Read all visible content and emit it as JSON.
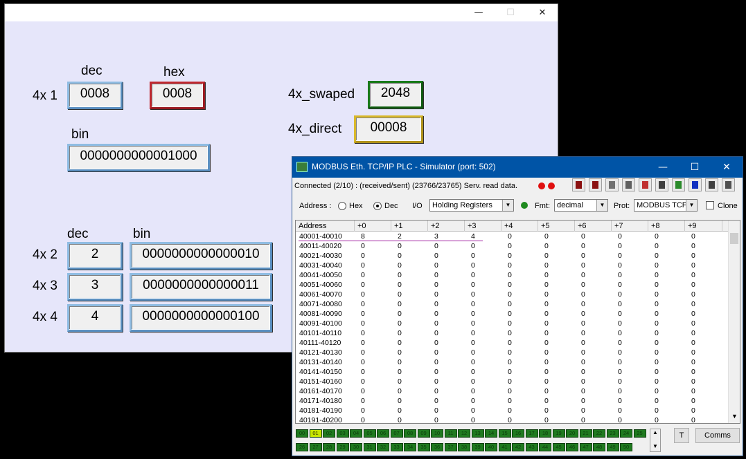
{
  "hmi": {
    "caption": {
      "minimize": "—",
      "maximize": "☐",
      "close": "✕"
    },
    "row1_label": "4x 1",
    "dec_header": "dec",
    "hex_header": "hex",
    "bin_header": "bin",
    "reg1_dec": "0008",
    "reg1_hex": "0008",
    "reg1_bin": "0000000000001000",
    "swaped_label": "4x_swaped",
    "swaped_value": "2048",
    "direct_label": "4x_direct",
    "direct_value": "00008",
    "lower_dec_header": "dec",
    "lower_bin_header": "bin",
    "rows": [
      {
        "label": "4x 2",
        "dec": "2",
        "bin": "0000000000000010"
      },
      {
        "label": "4x 3",
        "dec": "3",
        "bin": "0000000000000011"
      },
      {
        "label": "4x 4",
        "dec": "4",
        "bin": "0000000000000100"
      }
    ]
  },
  "sim": {
    "title": "MODBUS Eth. TCP/IP PLC - Simulator (port: 502)",
    "status": "Connected (2/10) : (received/sent) (23766/23765) Serv. read data.",
    "address_label": "Address :",
    "hex_label": "Hex",
    "dec_label": "Dec",
    "io_label": "I/O",
    "io_value": "Holding Registers",
    "fmt_label": "Fmt:",
    "fmt_value": "decimal",
    "prot_label": "Prot:",
    "prot_value": "MODBUS TCP",
    "clone_label": "Clone",
    "columns": [
      "Address",
      "+0",
      "+1",
      "+2",
      "+3",
      "+4",
      "+5",
      "+6",
      "+7",
      "+8",
      "+9"
    ],
    "rows": [
      {
        "addr": "40001-40010",
        "vals": [
          "8",
          "2",
          "3",
          "4",
          "0",
          "0",
          "0",
          "0",
          "0",
          "0"
        ]
      },
      {
        "addr": "40011-40020",
        "vals": [
          "0",
          "0",
          "0",
          "0",
          "0",
          "0",
          "0",
          "0",
          "0",
          "0"
        ]
      },
      {
        "addr": "40021-40030",
        "vals": [
          "0",
          "0",
          "0",
          "0",
          "0",
          "0",
          "0",
          "0",
          "0",
          "0"
        ]
      },
      {
        "addr": "40031-40040",
        "vals": [
          "0",
          "0",
          "0",
          "0",
          "0",
          "0",
          "0",
          "0",
          "0",
          "0"
        ]
      },
      {
        "addr": "40041-40050",
        "vals": [
          "0",
          "0",
          "0",
          "0",
          "0",
          "0",
          "0",
          "0",
          "0",
          "0"
        ]
      },
      {
        "addr": "40051-40060",
        "vals": [
          "0",
          "0",
          "0",
          "0",
          "0",
          "0",
          "0",
          "0",
          "0",
          "0"
        ]
      },
      {
        "addr": "40061-40070",
        "vals": [
          "0",
          "0",
          "0",
          "0",
          "0",
          "0",
          "0",
          "0",
          "0",
          "0"
        ]
      },
      {
        "addr": "40071-40080",
        "vals": [
          "0",
          "0",
          "0",
          "0",
          "0",
          "0",
          "0",
          "0",
          "0",
          "0"
        ]
      },
      {
        "addr": "40081-40090",
        "vals": [
          "0",
          "0",
          "0",
          "0",
          "0",
          "0",
          "0",
          "0",
          "0",
          "0"
        ]
      },
      {
        "addr": "40091-40100",
        "vals": [
          "0",
          "0",
          "0",
          "0",
          "0",
          "0",
          "0",
          "0",
          "0",
          "0"
        ]
      },
      {
        "addr": "40101-40110",
        "vals": [
          "0",
          "0",
          "0",
          "0",
          "0",
          "0",
          "0",
          "0",
          "0",
          "0"
        ]
      },
      {
        "addr": "40111-40120",
        "vals": [
          "0",
          "0",
          "0",
          "0",
          "0",
          "0",
          "0",
          "0",
          "0",
          "0"
        ]
      },
      {
        "addr": "40121-40130",
        "vals": [
          "0",
          "0",
          "0",
          "0",
          "0",
          "0",
          "0",
          "0",
          "0",
          "0"
        ]
      },
      {
        "addr": "40131-40140",
        "vals": [
          "0",
          "0",
          "0",
          "0",
          "0",
          "0",
          "0",
          "0",
          "0",
          "0"
        ]
      },
      {
        "addr": "40141-40150",
        "vals": [
          "0",
          "0",
          "0",
          "0",
          "0",
          "0",
          "0",
          "0",
          "0",
          "0"
        ]
      },
      {
        "addr": "40151-40160",
        "vals": [
          "0",
          "0",
          "0",
          "0",
          "0",
          "0",
          "0",
          "0",
          "0",
          "0"
        ]
      },
      {
        "addr": "40161-40170",
        "vals": [
          "0",
          "0",
          "0",
          "0",
          "0",
          "0",
          "0",
          "0",
          "0",
          "0"
        ]
      },
      {
        "addr": "40171-40180",
        "vals": [
          "0",
          "0",
          "0",
          "0",
          "0",
          "0",
          "0",
          "0",
          "0",
          "0"
        ]
      },
      {
        "addr": "40181-40190",
        "vals": [
          "0",
          "0",
          "0",
          "0",
          "0",
          "0",
          "0",
          "0",
          "0",
          "0"
        ]
      },
      {
        "addr": "40191-40200",
        "vals": [
          "0",
          "0",
          "0",
          "0",
          "0",
          "0",
          "0",
          "0",
          "0",
          "0"
        ]
      }
    ],
    "leds_row1": [
      "00",
      "01",
      "02",
      "03",
      "04",
      "05",
      "06",
      "07",
      "08",
      "09",
      "10",
      "11",
      "12",
      "13",
      "14",
      "15",
      "16",
      "17",
      "18",
      "19",
      "20",
      "21",
      "22",
      "23",
      "24",
      "25"
    ],
    "leds_row2": [
      "26",
      "27",
      "28",
      "29",
      "30",
      "31",
      "32",
      "33",
      "34",
      "35",
      "36",
      "37",
      "38",
      "39",
      "40",
      "41",
      "42",
      "43",
      "44",
      "45",
      "46",
      "47",
      "48",
      "49",
      "50"
    ],
    "active_led": "01",
    "t_button": "T",
    "comms_button": "Comms",
    "toolbar_icons": [
      "plc-icon",
      "plc-stop-icon",
      "eraser-icon",
      "display-icon",
      "person-icon",
      "signal-icon",
      "mod-rssim-icon",
      "monitor-icon",
      "columns-icon",
      "sliders-icon"
    ]
  },
  "colors": {
    "hmi_bg": "#e6e6fa",
    "title_blue": "#0054a6",
    "led_green": "#1f7a1f",
    "led_active": "#c8e600"
  }
}
